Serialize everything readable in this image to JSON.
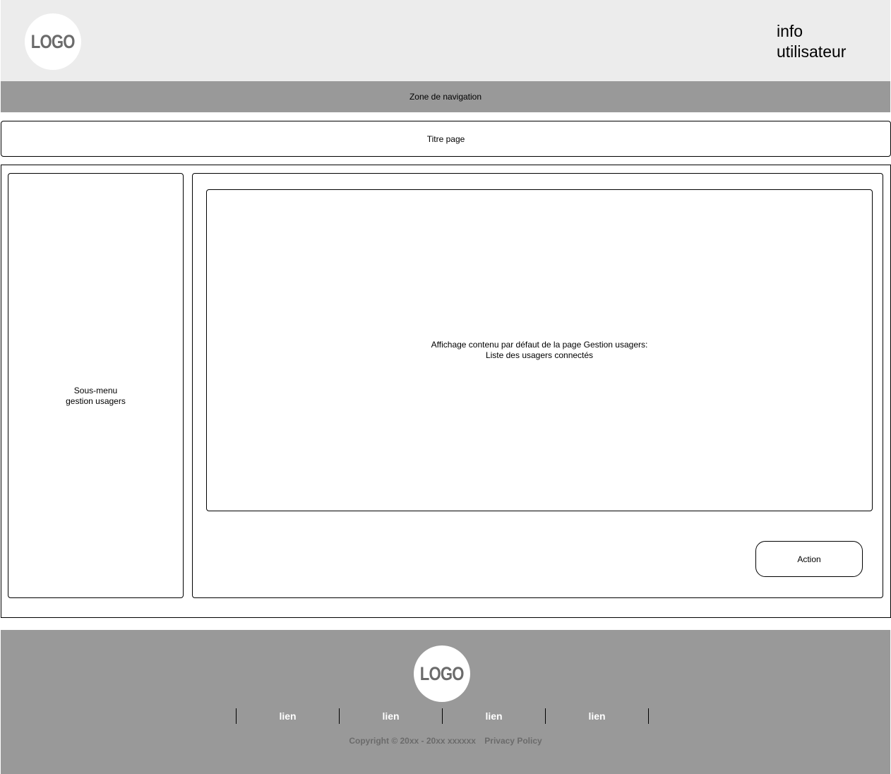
{
  "header": {
    "logo_text": "LOGO",
    "user_info_line1": "info",
    "user_info_line2": "utilisateur"
  },
  "nav": {
    "label": "Zone de navigation"
  },
  "page": {
    "title": "Titre page"
  },
  "submenu": {
    "line1": "Sous-menu",
    "line2": "gestion usagers"
  },
  "content": {
    "line1": "Affichage contenu par défaut de la page Gestion usagers:",
    "line2": "Liste des usagers connectés"
  },
  "action": {
    "label": "Action"
  },
  "footer": {
    "logo_text": "LOGO",
    "links": [
      "lien",
      "lien",
      "lien",
      "lien"
    ],
    "copyright": "Copyright © 20xx - 20xx xxxxxx",
    "privacy": "Privacy Policy"
  },
  "colors": {
    "header_bg": "#ececec",
    "nav_bg": "#999999",
    "footer_bg": "#999999",
    "logo_text": "#6b6b6b"
  }
}
